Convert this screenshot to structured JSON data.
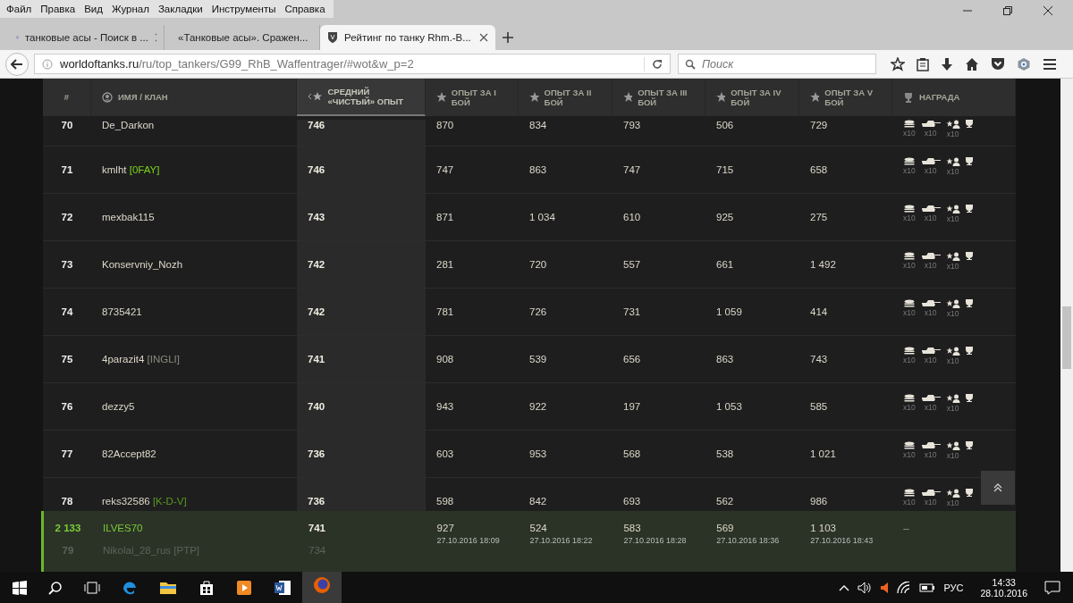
{
  "menu_bar": [
    "Файл",
    "Правка",
    "Вид",
    "Журнал",
    "Закладки",
    "Инструменты",
    "Справка"
  ],
  "tabs": [
    {
      "title": "танковые асы - Поиск в ...",
      "kind": "search",
      "selected": false
    },
    {
      "title": "«Танковые асы». Сражен...",
      "kind": "site",
      "selected": false
    },
    {
      "title": "Рейтинг по танку Rhm.-B...",
      "kind": "site",
      "selected": true
    }
  ],
  "address_bar": {
    "host": "worldoftanks.ru",
    "path": "/ru/top_tankers/G99_RhB_Waffentrager/#wot&w_p=2"
  },
  "search": {
    "placeholder": "Поиск"
  },
  "table": {
    "columns": [
      {
        "label": "#",
        "kind": "rank",
        "selected": false
      },
      {
        "label": "ИМЯ / КЛАН",
        "kind": "player",
        "selected": false
      },
      {
        "label": "СРЕДНИЙ «ЧИСТЫЙ» ОПЫТ",
        "kind": "average",
        "selected": true
      },
      {
        "label": "ОПЫТ ЗА I БОЙ",
        "kind": "battle",
        "selected": false
      },
      {
        "label": "ОПЫТ ЗА II БОЙ",
        "kind": "battle",
        "selected": false
      },
      {
        "label": "ОПЫТ ЗА III БОЙ",
        "kind": "battle",
        "selected": false
      },
      {
        "label": "ОПЫТ ЗА IV БОЙ",
        "kind": "battle",
        "selected": false
      },
      {
        "label": "ОПЫТ ЗА V БОЙ",
        "kind": "battle",
        "selected": false
      },
      {
        "label": "НАГРАДА",
        "kind": "award",
        "selected": false
      }
    ],
    "rows": [
      {
        "rank": "70",
        "name": "De_Darkon",
        "avg": "746",
        "battles": [
          "870",
          "834",
          "793",
          "506",
          "729"
        ],
        "rewards": [
          {
            "kind": "coins",
            "count": "x10"
          },
          {
            "kind": "tank",
            "count": "x10"
          },
          {
            "kind": "crew",
            "count": "x10"
          },
          {
            "kind": "cup"
          }
        ]
      },
      {
        "rank": "71",
        "name": "kmlht",
        "clan": "[0FAY]",
        "color": "#7ad21a",
        "avg": "746",
        "battles": [
          "747",
          "863",
          "747",
          "715",
          "658"
        ],
        "rewards": [
          {
            "kind": "coins",
            "count": "x10"
          },
          {
            "kind": "tank",
            "count": "x10"
          },
          {
            "kind": "crew",
            "count": "x10"
          },
          {
            "kind": "cup"
          }
        ]
      },
      {
        "rank": "72",
        "name": "mexbak115",
        "avg": "743",
        "battles": [
          "871",
          "1 034",
          "610",
          "925",
          "275"
        ],
        "rewards": [
          {
            "kind": "coins",
            "count": "x10"
          },
          {
            "kind": "tank",
            "count": "x10"
          },
          {
            "kind": "crew",
            "count": "x10"
          },
          {
            "kind": "cup"
          }
        ]
      },
      {
        "rank": "73",
        "name": "Konservniy_Nozh",
        "avg": "742",
        "battles": [
          "281",
          "720",
          "557",
          "661",
          "1 492"
        ],
        "rewards": [
          {
            "kind": "coins",
            "count": "x10"
          },
          {
            "kind": "tank",
            "count": "x10"
          },
          {
            "kind": "crew",
            "count": "x10"
          },
          {
            "kind": "cup"
          }
        ]
      },
      {
        "rank": "74",
        "name": "8735421",
        "avg": "742",
        "battles": [
          "781",
          "726",
          "731",
          "1 059",
          "414"
        ],
        "rewards": [
          {
            "kind": "coins",
            "count": "x10"
          },
          {
            "kind": "tank",
            "count": "x10"
          },
          {
            "kind": "crew",
            "count": "x10"
          },
          {
            "kind": "cup"
          }
        ]
      },
      {
        "rank": "75",
        "name": "4parazit4",
        "clan": "[INGLI]",
        "color": "#8a8a80",
        "avg": "741",
        "battles": [
          "908",
          "539",
          "656",
          "863",
          "743"
        ],
        "rewards": [
          {
            "kind": "coins",
            "count": "x10"
          },
          {
            "kind": "tank",
            "count": "x10"
          },
          {
            "kind": "crew",
            "count": "x10"
          },
          {
            "kind": "cup"
          }
        ]
      },
      {
        "rank": "76",
        "name": "dezzy5",
        "avg": "740",
        "battles": [
          "943",
          "922",
          "197",
          "1 053",
          "585"
        ],
        "rewards": [
          {
            "kind": "coins",
            "count": "x10"
          },
          {
            "kind": "tank",
            "count": "x10"
          },
          {
            "kind": "crew",
            "count": "x10"
          },
          {
            "kind": "cup"
          }
        ]
      },
      {
        "rank": "77",
        "name": "82Accept82",
        "avg": "736",
        "battles": [
          "603",
          "953",
          "568",
          "538",
          "1 021"
        ],
        "rewards": [
          {
            "kind": "coins",
            "count": "x10"
          },
          {
            "kind": "tank",
            "count": "x10"
          },
          {
            "kind": "crew",
            "count": "x10"
          },
          {
            "kind": "cup"
          }
        ]
      },
      {
        "rank": "78",
        "name": "reks32586",
        "clan": "[K-D-V]",
        "color": "#5a9a1e",
        "avg": "736",
        "battles": [
          "598",
          "842",
          "693",
          "562",
          "986"
        ],
        "rewards": [
          {
            "kind": "coins",
            "count": "x10"
          },
          {
            "kind": "tank",
            "count": "x10"
          },
          {
            "kind": "crew",
            "count": "x10"
          },
          {
            "kind": "cup"
          }
        ]
      }
    ],
    "own_row": {
      "rank": "2 133",
      "name": "ILVES70",
      "avg": "741",
      "battles": [
        {
          "exp": "927",
          "date": "27.10.2016 18:09"
        },
        {
          "exp": "524",
          "date": "27.10.2016 18:22"
        },
        {
          "exp": "583",
          "date": "27.10.2016 18:28"
        },
        {
          "exp": "569",
          "date": "27.10.2016 18:36"
        },
        {
          "exp": "1 103",
          "date": "27.10.2016 18:43"
        }
      ],
      "reward": "–"
    },
    "row_behind": {
      "rank": "79",
      "name": "Nikolai_28_rus",
      "clan": "[PTP]",
      "avg": "734"
    }
  },
  "taskbar": {
    "language": "РУС",
    "time": "14:33",
    "date": "28.10.2016"
  }
}
